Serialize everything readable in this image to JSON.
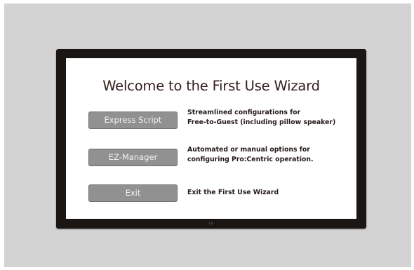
{
  "wizard": {
    "title": "Welcome to the First Use Wizard",
    "options": [
      {
        "button_label": "Express Script",
        "description_line1": "Streamlined configurations for",
        "description_line2": "Free-to-Guest (including pillow speaker)"
      },
      {
        "button_label": "EZ-Manager",
        "description_line1": "Automated or manual options for",
        "description_line2": "configuring Pro:Centric operation."
      },
      {
        "button_label": "Exit",
        "description_line1": "Exit the First Use Wizard"
      }
    ]
  },
  "tv": {
    "logo_text": "LG"
  },
  "colors": {
    "backdrop": "#d3d3d3",
    "frame": "#1a1614",
    "screen": "#ffffff",
    "title": "#331e1b",
    "button_fill": "#919191",
    "button_text": "#f2f2f2"
  }
}
